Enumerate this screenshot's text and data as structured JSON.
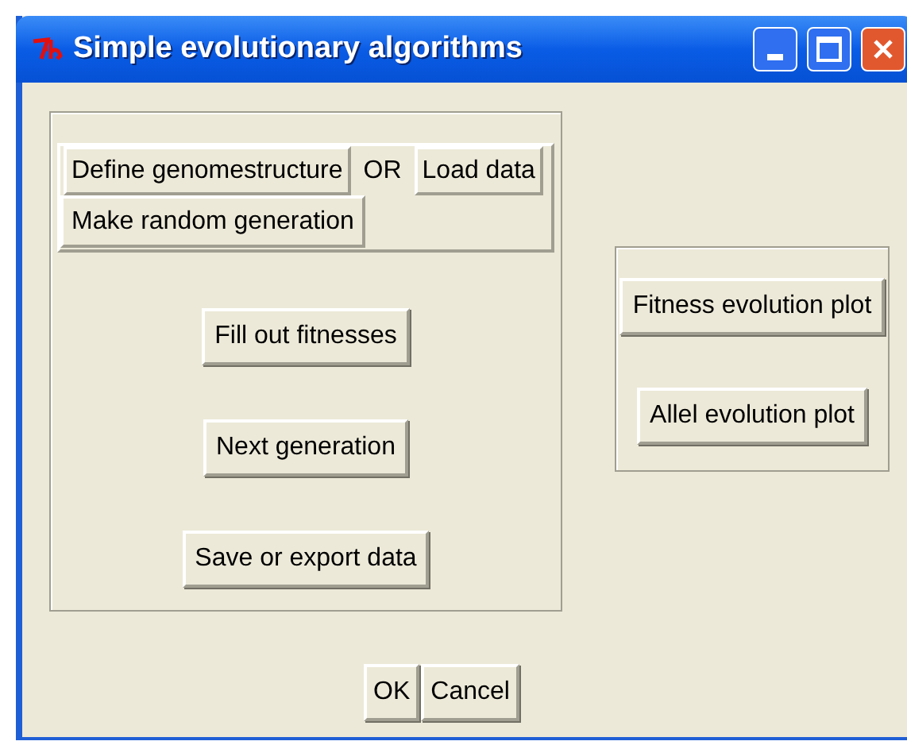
{
  "window": {
    "title": "Simple evolutionary algorithms"
  },
  "data_panel": {
    "define_button": "Define genomestructure",
    "separator": "OR",
    "load_button": "Load data",
    "random_button": "Make random generation"
  },
  "actions": [
    "Fill out fitnesses",
    "Next generation",
    "Save or export data"
  ],
  "plots": [
    "Fitness evolution plot",
    "Allel evolution plot"
  ],
  "dialog_buttons": [
    "OK",
    "Cancel"
  ]
}
